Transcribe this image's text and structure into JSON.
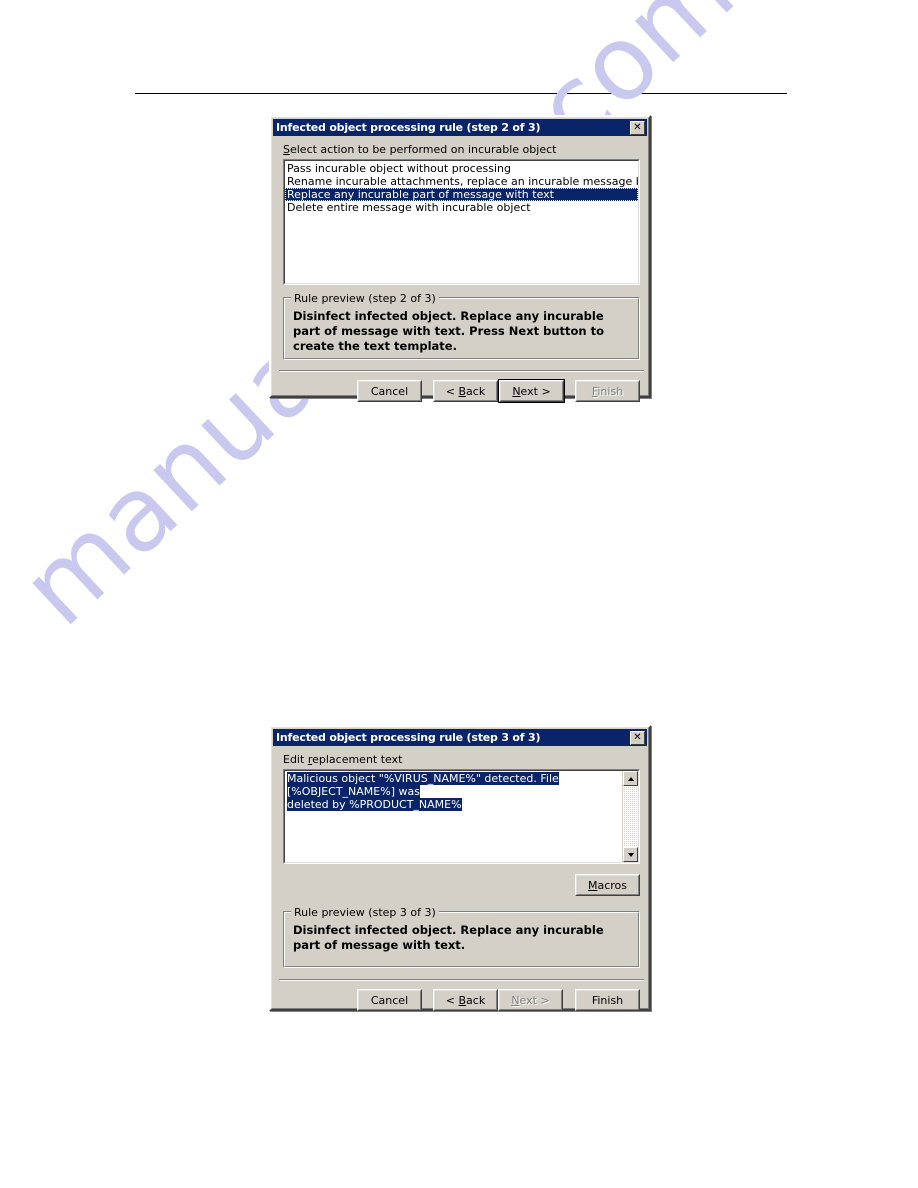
{
  "page": {
    "watermark": "manualshive.com",
    "watermark_color": "#c9c9ef",
    "rule_color": "#000000",
    "background": "#ffffff"
  },
  "theme": {
    "dialog_face": "#d4d0c8",
    "titlebar": "#0a246a",
    "selection": "#0a246a",
    "selection_text": "#ffffff",
    "disabled_text": "#808080"
  },
  "dialog_step2": {
    "title": "Infected object processing rule (step 2 of 3)",
    "close_icon": "close-icon",
    "close_glyph": "✕",
    "list_label_pre": "S",
    "list_label_post": "elect action to be performed on incurable object",
    "list_items": [
      {
        "label": "Pass incurable object without processing",
        "selected": false
      },
      {
        "label": "Rename incurable attachments, replace an incurable message body with text",
        "selected": false
      },
      {
        "label": "Replace any incurable part of message with text",
        "selected": true
      },
      {
        "label": "Delete entire message with incurable object",
        "selected": false
      }
    ],
    "preview": {
      "legend": "Rule preview (step 2 of 3)",
      "text": "Disinfect infected object. Replace any incurable part of message with text. Press Next button to create the text template."
    },
    "buttons": [
      {
        "name": "cancel-button",
        "label": "Cancel",
        "pre": "",
        "key": "",
        "post": "Cancel",
        "enabled": true,
        "default": false
      },
      {
        "name": "back-button",
        "label": "< Back",
        "pre": "< ",
        "key": "B",
        "post": "ack",
        "enabled": true,
        "default": false
      },
      {
        "name": "next-button",
        "label": "Next >",
        "pre": "",
        "key": "N",
        "post": "ext >",
        "enabled": true,
        "default": true
      },
      {
        "name": "finish-button",
        "label": "Finish",
        "pre": "",
        "key": "F",
        "post": "inish",
        "enabled": false,
        "default": false
      }
    ]
  },
  "dialog_step3": {
    "title": "Infected object processing rule (step 3 of 3)",
    "close_icon": "close-icon",
    "close_glyph": "✕",
    "edit_label_pre": "Edit ",
    "edit_label_key": "r",
    "edit_label_post": "eplacement text",
    "replacement_text": "Malicious object \"%VIRUS_NAME%\" detected. File [%OBJECT_NAME%] was deleted by %PRODUCT_NAME%",
    "replacement_text_line1": "Malicious object \"%VIRUS_NAME%\" detected. File [%OBJECT_NAME%] was",
    "replacement_text_line2": "deleted by %PRODUCT_NAME%",
    "scrollbar": {
      "up_icon": "scroll-up-arrow-icon",
      "down_icon": "scroll-down-arrow-icon"
    },
    "macros_button": {
      "name": "macros-button",
      "label": "Macros",
      "pre": "",
      "key": "M",
      "post": "acros"
    },
    "preview": {
      "legend": "Rule preview (step 3 of 3)",
      "text": "Disinfect infected object. Replace any incurable part of message with text."
    },
    "buttons": [
      {
        "name": "cancel-button",
        "label": "Cancel",
        "pre": "",
        "key": "",
        "post": "Cancel",
        "enabled": true,
        "default": false
      },
      {
        "name": "back-button",
        "label": "< Back",
        "pre": "< ",
        "key": "B",
        "post": "ack",
        "enabled": true,
        "default": false
      },
      {
        "name": "next-button",
        "label": "Next >",
        "pre": "",
        "key": "N",
        "post": "ext >",
        "enabled": false,
        "default": false
      },
      {
        "name": "finish-button",
        "label": "Finish",
        "pre": "",
        "key": "",
        "post": "Finish",
        "enabled": true,
        "default": false
      }
    ]
  }
}
